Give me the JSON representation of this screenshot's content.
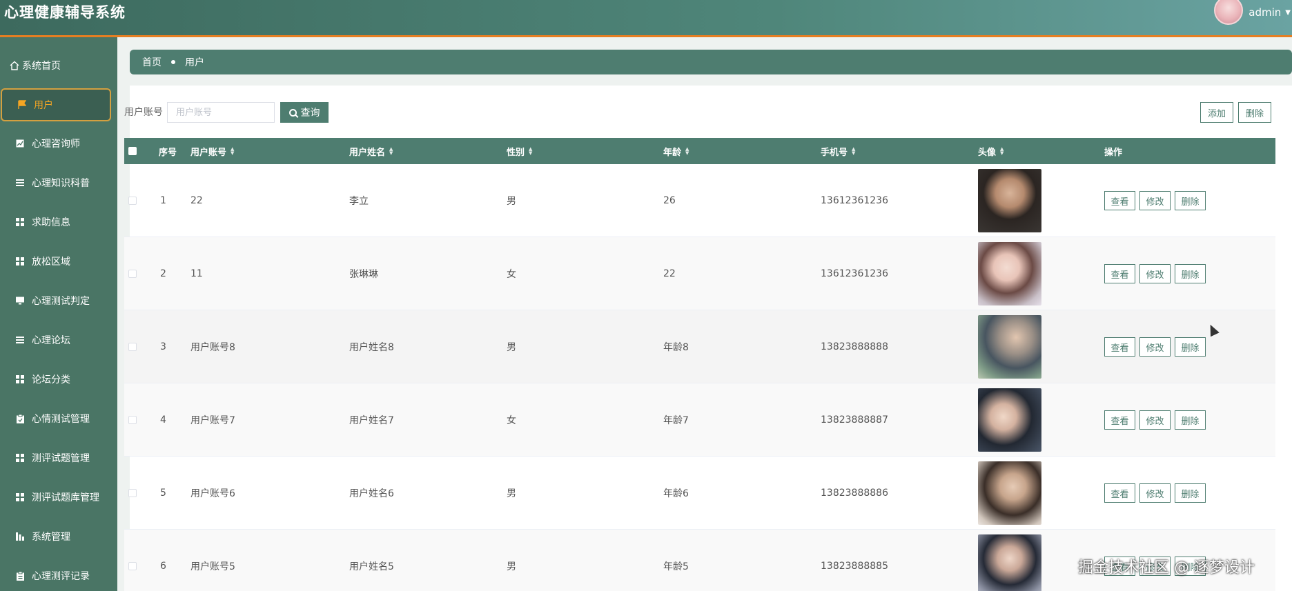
{
  "header": {
    "title": "心理健康辅导系统",
    "username": "admin"
  },
  "sidebar": {
    "items": [
      {
        "label": "系统首页",
        "icon": "home-icon"
      },
      {
        "label": "用户",
        "icon": "flag-icon",
        "active": true
      },
      {
        "label": "心理咨询师",
        "icon": "chart-icon"
      },
      {
        "label": "心理知识科普",
        "icon": "list-icon"
      },
      {
        "label": "求助信息",
        "icon": "grid-icon"
      },
      {
        "label": "放松区域",
        "icon": "grid-icon"
      },
      {
        "label": "心理测试判定",
        "icon": "monitor-icon"
      },
      {
        "label": "心理论坛",
        "icon": "list-icon"
      },
      {
        "label": "论坛分类",
        "icon": "grid-icon"
      },
      {
        "label": "心情测试管理",
        "icon": "clipboard-icon"
      },
      {
        "label": "测评试题管理",
        "icon": "grid-icon"
      },
      {
        "label": "测评试题库管理",
        "icon": "grid-icon"
      },
      {
        "label": "系统管理",
        "icon": "bar-chart-icon"
      },
      {
        "label": "心理测评记录",
        "icon": "clipboard-icon"
      }
    ]
  },
  "breadcrumb": {
    "home": "首页",
    "current": "用户"
  },
  "search": {
    "label": "用户账号",
    "placeholder": "用户账号",
    "button": "查询"
  },
  "toolbar": {
    "add": "添加",
    "delete": "删除"
  },
  "table": {
    "columns": [
      "序号",
      "用户账号",
      "用户姓名",
      "性别",
      "年龄",
      "手机号",
      "头像",
      "操作"
    ],
    "rows": [
      {
        "index": "1",
        "account": "22",
        "name": "李立",
        "gender": "男",
        "age": "26",
        "phone": "13612361236"
      },
      {
        "index": "2",
        "account": "11",
        "name": "张琳琳",
        "gender": "女",
        "age": "22",
        "phone": "13612361236"
      },
      {
        "index": "3",
        "account": "用户账号8",
        "name": "用户姓名8",
        "gender": "男",
        "age": "年龄8",
        "phone": "13823888888"
      },
      {
        "index": "4",
        "account": "用户账号7",
        "name": "用户姓名7",
        "gender": "女",
        "age": "年龄7",
        "phone": "13823888887"
      },
      {
        "index": "5",
        "account": "用户账号6",
        "name": "用户姓名6",
        "gender": "男",
        "age": "年龄6",
        "phone": "13823888886"
      },
      {
        "index": "6",
        "account": "用户账号5",
        "name": "用户姓名5",
        "gender": "男",
        "age": "年龄5",
        "phone": "13823888885"
      }
    ],
    "actions": {
      "view": "查看",
      "edit": "修改",
      "delete": "删除"
    }
  },
  "watermark": "掘金技术社区 @ 逐梦设计",
  "colors": {
    "primary": "#4e7d70",
    "sidebar": "#4a7565",
    "accent": "#f5a623",
    "header_border": "#e67e22"
  }
}
